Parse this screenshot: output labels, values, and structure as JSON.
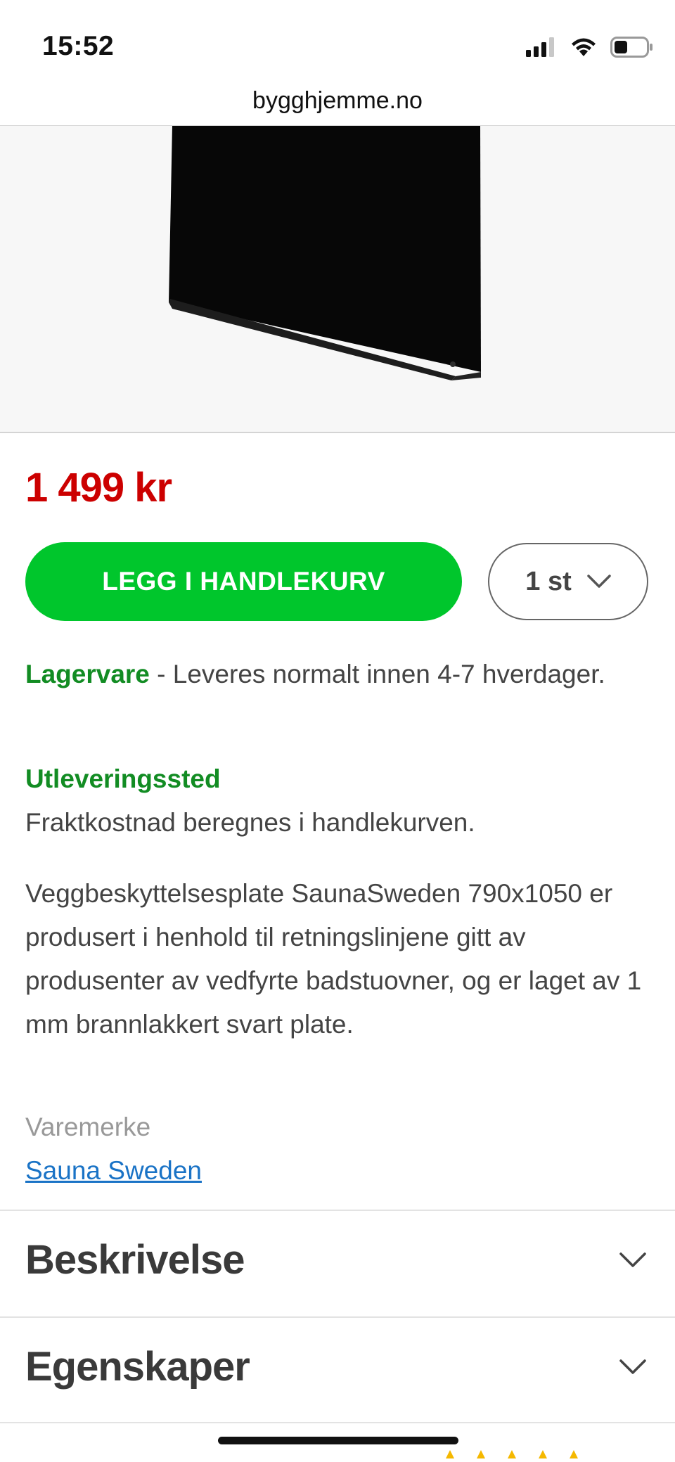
{
  "status_bar": {
    "time": "15:52",
    "signal_icon": "cellular-signal-icon",
    "wifi_icon": "wifi-icon",
    "battery_icon": "battery-icon"
  },
  "browser": {
    "url": "bygghjemme.no"
  },
  "gallery": {
    "active_index": 1,
    "total": 2
  },
  "product": {
    "price": "1 499 kr",
    "add_to_cart_label": "LEGG I HANDLEKURV",
    "quantity_label": "1 st",
    "stock_status": "Lagervare",
    "stock_detail": " - Leveres normalt innen 4-7 hverdager.",
    "pickup_label": "Utleveringssted",
    "shipping_note": "Fraktkostnad beregnes i handlekurven.",
    "description": "Veggbeskyttelsesplate SaunaSweden 790x1050 er produsert i henhold til retningslinjene gitt av produsenter av vedfyrte badstuovner, og er laget av 1 mm brannlakkert svart plate.",
    "brand_label": "Varemerke",
    "brand_name": "Sauna Sweden"
  },
  "sections": [
    {
      "title": "Beskrivelse"
    },
    {
      "title": "Egenskaper"
    }
  ],
  "colors": {
    "price": "#cc0000",
    "cta": "#00c62c",
    "stock": "#128c23",
    "link": "#1a73c6",
    "rating_star": "#f5b800"
  }
}
